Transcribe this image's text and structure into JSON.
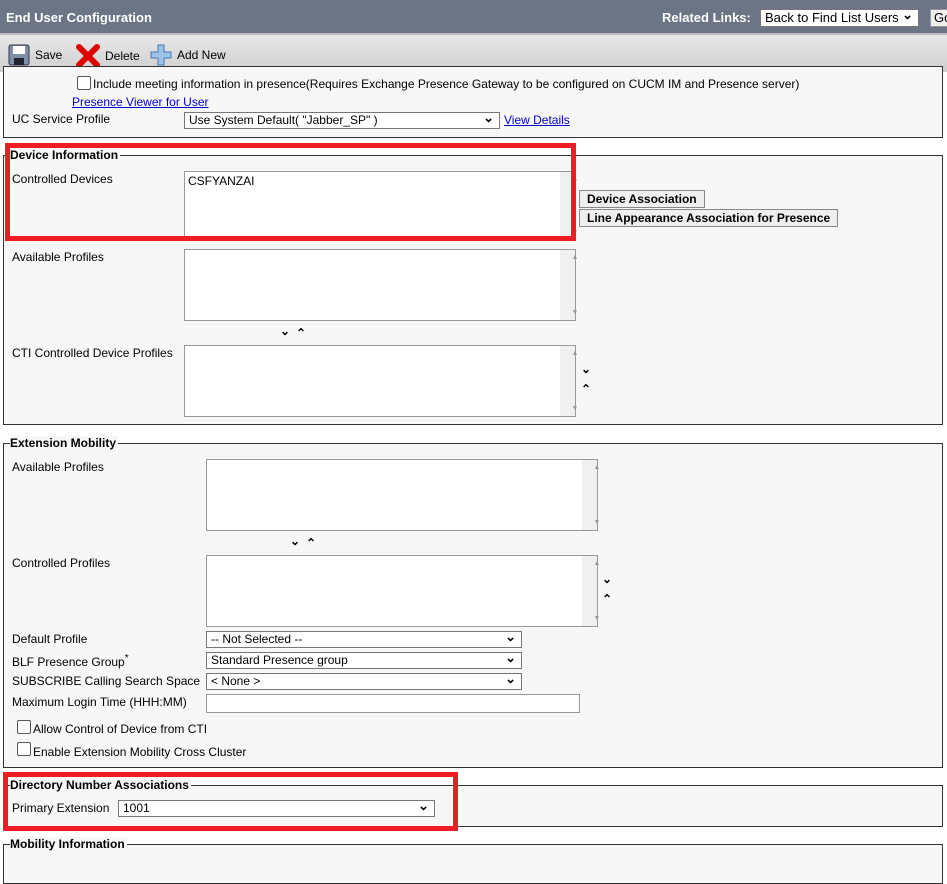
{
  "header": {
    "title": "End User Configuration",
    "related_links_label": "Related Links:",
    "related_links_value": "Back to Find List Users",
    "go_label": "Go"
  },
  "toolbar": {
    "save": "Save",
    "delete": "Delete",
    "add_new": "Add New"
  },
  "presence": {
    "include_meeting_label": "Include meeting information in presence(Requires Exchange Presence Gateway to be configured on CUCM IM and Presence server)",
    "viewer_link": "Presence Viewer for User",
    "uc_service_profile_label": "UC Service Profile",
    "uc_service_profile_value": "Use System Default( \"Jabber_SP\" )",
    "view_details": "View Details"
  },
  "device_info": {
    "legend": "Device Information",
    "controlled_devices_label": "Controlled Devices",
    "controlled_devices": [
      "CSFYANZAI"
    ],
    "device_association": "Device Association",
    "line_appearance": "Line Appearance Association for Presence",
    "available_profiles_label": "Available Profiles",
    "cti_profiles_label": "CTI Controlled Device Profiles"
  },
  "extension_mobility": {
    "legend": "Extension Mobility",
    "available_profiles_label": "Available Profiles",
    "controlled_profiles_label": "Controlled Profiles",
    "default_profile_label": "Default Profile",
    "default_profile_value": "-- Not Selected --",
    "blf_label": "BLF Presence Group",
    "required_mark": "*",
    "blf_value": "Standard Presence group",
    "subscribe_label": "SUBSCRIBE Calling Search Space",
    "subscribe_value": "< None >",
    "max_login_label": "Maximum Login Time (HHH:MM)",
    "max_login_value": "",
    "allow_cti_label": "Allow Control of Device from CTI",
    "allow_cti_checked": false,
    "cross_cluster_label": "Enable Extension Mobility Cross Cluster",
    "cross_cluster_checked": false
  },
  "directory_number": {
    "legend": "Directory Number Associations",
    "primary_extension_label": "Primary Extension",
    "primary_extension_value": "1001"
  },
  "mobility": {
    "legend": "Mobility Information"
  },
  "colors": {
    "header_bg": "#6b7585",
    "highlight": "#ee1c25"
  }
}
